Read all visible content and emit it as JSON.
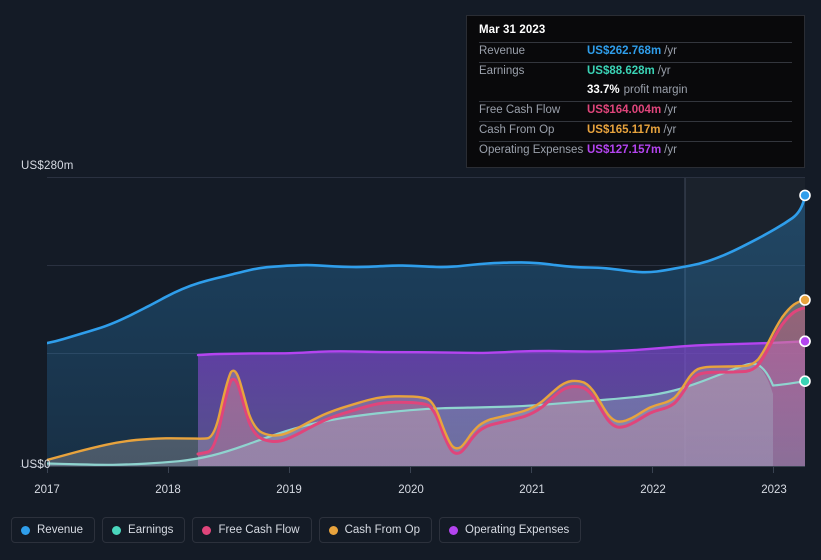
{
  "axes": {
    "y_top_label": "US$280m",
    "y_zero_label": "US$0",
    "x_labels": [
      "2017",
      "2018",
      "2019",
      "2020",
      "2021",
      "2022",
      "2023"
    ]
  },
  "tooltip": {
    "date": "Mar 31 2023",
    "rows": [
      {
        "label": "Revenue",
        "value": "US$262.768m",
        "unit": "/yr",
        "color": "#2f9eeb"
      },
      {
        "label": "Earnings",
        "value": "US$88.628m",
        "unit": "/yr",
        "color": "#3ad3b5"
      },
      {
        "label": "Free Cash Flow",
        "value": "US$164.004m",
        "unit": "/yr",
        "color": "#e0457b"
      },
      {
        "label": "Cash From Op",
        "value": "US$165.117m",
        "unit": "/yr",
        "color": "#e8a33d"
      },
      {
        "label": "Operating Expenses",
        "value": "US$127.157m",
        "unit": "/yr",
        "color": "#b444f0"
      }
    ],
    "margin_value": "33.7%",
    "margin_label": "profit margin"
  },
  "legend": [
    {
      "label": "Revenue",
      "color": "#2f9eeb"
    },
    {
      "label": "Earnings",
      "color": "#4ad6bd"
    },
    {
      "label": "Free Cash Flow",
      "color": "#e0457b"
    },
    {
      "label": "Cash From Op",
      "color": "#e8a33d"
    },
    {
      "label": "Operating Expenses",
      "color": "#b444f0"
    }
  ],
  "colors": {
    "background": "#141b26",
    "gridline": "#2a3140",
    "revenue": "#2f9eeb",
    "earnings": "#8fd4cf",
    "free_cash_flow": "#e0457b",
    "cash_from_op": "#e8a33d",
    "operating_expenses": "#b444f0"
  },
  "chart_data": {
    "type": "area",
    "title": "",
    "xlabel": "",
    "ylabel": "US$",
    "ylim": [
      0,
      280
    ],
    "grid": true,
    "legend_position": "bottom",
    "y_gridlines": [
      0,
      100,
      190,
      280
    ],
    "x": [
      "2017.0",
      "2017.25",
      "2017.5",
      "2017.75",
      "2018.0",
      "2018.25",
      "2018.5",
      "2018.75",
      "2019.0",
      "2019.25",
      "2019.5",
      "2019.75",
      "2020.0",
      "2020.25",
      "2020.5",
      "2020.75",
      "2021.0",
      "2021.25",
      "2021.5",
      "2021.75",
      "2022.0",
      "2022.25",
      "2022.5",
      "2022.75",
      "2023.0",
      "2023.25"
    ],
    "x_tick_positions": [
      "2017",
      "2018",
      "2019",
      "2020",
      "2021",
      "2022",
      "2023"
    ],
    "series": [
      {
        "name": "Revenue",
        "color": "#2f9eeb",
        "values": [
          119,
          122,
          126,
          130,
          134,
          140,
          147,
          155,
          163,
          169,
          173,
          176,
          178,
          180,
          180,
          179,
          181,
          184,
          187,
          189,
          188,
          185,
          188,
          196,
          215,
          263
        ]
      },
      {
        "name": "Earnings",
        "color": "#8fd4cf",
        "values": [
          4,
          4,
          3,
          3,
          4,
          7,
          12,
          19,
          25,
          30,
          33,
          36,
          39,
          42,
          44,
          45,
          46,
          48,
          50,
          52,
          54,
          57,
          63,
          71,
          79,
          89
        ]
      },
      {
        "name": "Free Cash Flow",
        "color": "#e0457b",
        "values": [
          null,
          null,
          null,
          null,
          10,
          40,
          88,
          60,
          22,
          18,
          25,
          38,
          55,
          72,
          78,
          77,
          50,
          42,
          48,
          62,
          88,
          62,
          54,
          66,
          112,
          164
        ]
      },
      {
        "name": "Cash From Op",
        "color": "#e8a33d",
        "values": [
          6,
          11,
          16,
          20,
          22,
          47,
          90,
          62,
          25,
          20,
          27,
          40,
          57,
          74,
          80,
          79,
          52,
          44,
          50,
          64,
          90,
          64,
          56,
          68,
          114,
          165
        ]
      },
      {
        "name": "Operating Expenses",
        "color": "#b444f0",
        "values": [
          null,
          null,
          null,
          null,
          108,
          109,
          110,
          110,
          110,
          112,
          113,
          112,
          112,
          111,
          111,
          110,
          110,
          112,
          113,
          113,
          114,
          116,
          119,
          122,
          125,
          127
        ]
      }
    ],
    "end_markers": [
      {
        "series": "Revenue",
        "value": 263
      },
      {
        "series": "Cash From Op",
        "value": 165
      },
      {
        "series": "Free Cash Flow",
        "value": 164
      },
      {
        "series": "Operating Expenses",
        "value": 127
      },
      {
        "series": "Earnings",
        "value": 89
      }
    ],
    "highlight_band": {
      "from": "2022.6",
      "to": "2023.25"
    }
  }
}
